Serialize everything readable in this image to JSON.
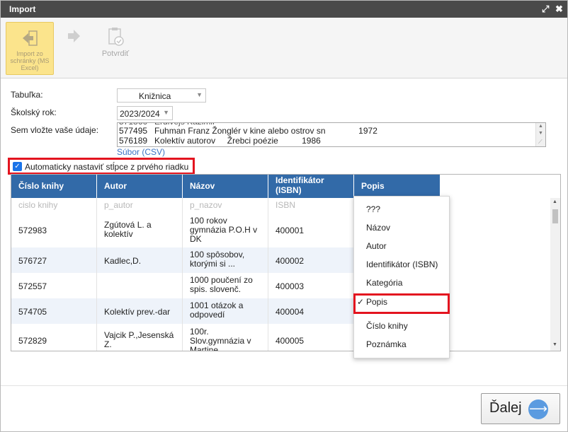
{
  "window": {
    "title": "Import",
    "resize_icon": "resize-icon",
    "close_icon": "close-icon"
  },
  "toolbar": {
    "import_label": "Import zo schránky (MS Excel)",
    "import_icon": "import-arrow-icon",
    "next_icon": "forward-arrow-icon",
    "confirm_label": "Potvrdiť",
    "confirm_icon": "clipboard-check-icon"
  },
  "form": {
    "table_label": "Tabuľka:",
    "table_value": "Knižnica",
    "year_label": "Školský rok:",
    "year_value": "2023/2024",
    "data_label": "Sem vložte vaše údaje:",
    "textarea_lines": [
      "577495   Fuhman Franz Žonglér v kine alebo ostrov sn              1972",
      "576189   Kolektív autorov     Žrebci poézie          1986"
    ],
    "file_link": "Súbor (CSV)",
    "auto_columns_label": "Automaticky nastaviť stĺpce z prvého riadku",
    "auto_columns_checked": true
  },
  "grid": {
    "columns": [
      "Číslo knihy",
      "Autor",
      "Názov",
      "Identifikátor (ISBN)",
      "Popis"
    ],
    "mapping": [
      "cislo knihy",
      "p_autor",
      "p_nazov",
      "ISBN",
      ""
    ],
    "rows": [
      [
        "572983",
        "Zgútová L. a kolektív",
        "100 rokov gymnázia P.O.H v DK",
        "400001",
        ""
      ],
      [
        "576727",
        "Kadlec,D.",
        "100 spôsobov, ktorými si ...",
        "400002",
        ""
      ],
      [
        "572557",
        "",
        "1000 poučení zo spis. slovenč.",
        "400003",
        ""
      ],
      [
        "574705",
        "Kolektív prev.-dar",
        "1001 otázok a odpovedí",
        "400004",
        ""
      ],
      [
        "572829",
        "Vajcik P.,Jesenská Z.",
        "100r. Slov.gymnázia v Martine",
        "400005",
        ""
      ]
    ]
  },
  "dropdown": {
    "items": [
      "???",
      "Názov",
      "Autor",
      "Identifikátor (ISBN)",
      "Kategória",
      "Popis",
      "Číslo knihy",
      "Poznámka"
    ],
    "selected": "Popis",
    "check_mark": "✓"
  },
  "footer": {
    "next_label": "Ďalej",
    "next_icon": "arrow-right-circle-icon"
  },
  "colors": {
    "header_blue": "#326aa8",
    "highlight_red": "#e3141f",
    "toolbar_yellow": "#fbe48c"
  }
}
